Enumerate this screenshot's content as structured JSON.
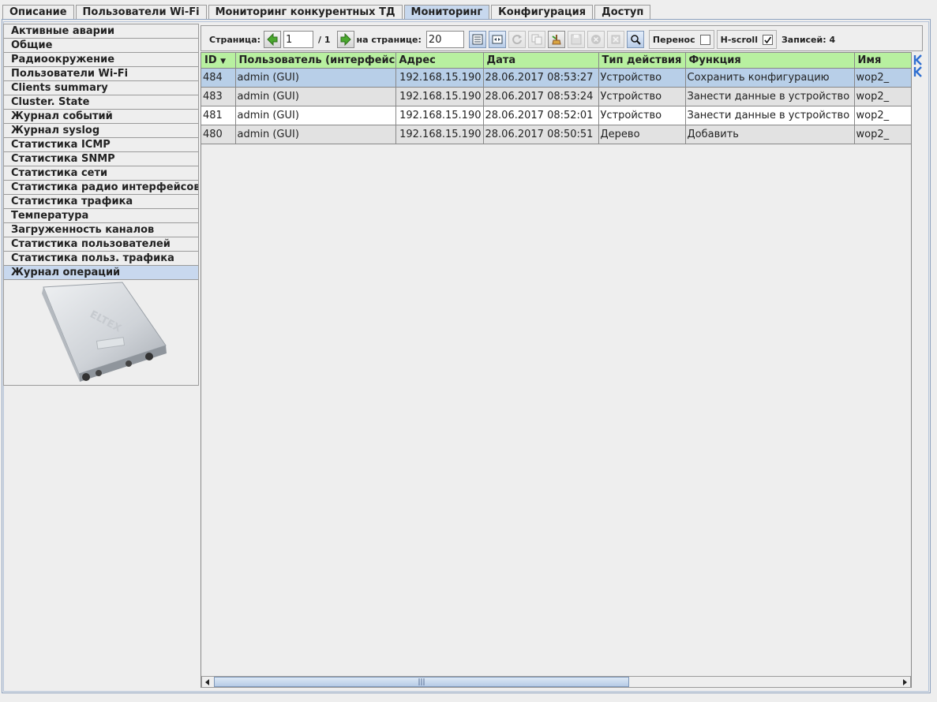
{
  "tabs": [
    {
      "label": "Описание",
      "active": false
    },
    {
      "label": "Пользователи Wi-Fi",
      "active": false
    },
    {
      "label": "Мониторинг конкурентных ТД",
      "active": false
    },
    {
      "label": "Мониторинг",
      "active": true
    },
    {
      "label": "Конфигурация",
      "active": false
    },
    {
      "label": "Доступ",
      "active": false
    }
  ],
  "sidebar": {
    "items": [
      {
        "label": "Активные аварии"
      },
      {
        "label": "Общие"
      },
      {
        "label": "Радиоокружение"
      },
      {
        "label": "Пользователи Wi-Fi"
      },
      {
        "label": "Clients summary"
      },
      {
        "label": "Cluster. State"
      },
      {
        "label": "Журнал событий"
      },
      {
        "label": "Журнал syslog"
      },
      {
        "label": "Статистика ICMP"
      },
      {
        "label": "Статистика SNMP"
      },
      {
        "label": "Статистика сети"
      },
      {
        "label": "Статистика радио интерфейсов"
      },
      {
        "label": "Статистика трафика"
      },
      {
        "label": "Температура"
      },
      {
        "label": "Загруженность каналов"
      },
      {
        "label": "Статистика пользователей"
      },
      {
        "label": "Статистика польз. трафика"
      },
      {
        "label": "Журнал операций",
        "active": true
      }
    ],
    "device_logo": "ELTEX"
  },
  "toolbar": {
    "page_label": "Страница:",
    "page_value": "1",
    "page_total": "/ 1",
    "per_page_label": "на странице:",
    "per_page_value": "20",
    "wrap_label": "Перенос",
    "wrap_checked": false,
    "hscroll_label": "H-scroll",
    "hscroll_checked": true,
    "records_label": "Записей: 4"
  },
  "table": {
    "columns": [
      "ID",
      "Пользователь (интерфейс)",
      "Адрес",
      "Дата",
      "Тип действия",
      "Функция",
      "Имя"
    ],
    "sort_column": "ID",
    "rows": [
      {
        "id": "484",
        "user": "admin (GUI)",
        "address": "192.168.15.190",
        "date": "28.06.2017 08:53:27",
        "action": "Устройство",
        "function": "Сохранить конфигурацию",
        "name": "wop2_",
        "selected": true
      },
      {
        "id": "483",
        "user": "admin (GUI)",
        "address": "192.168.15.190",
        "date": "28.06.2017 08:53:24",
        "action": "Устройство",
        "function": "Занести данные в устройство",
        "name": "wop2_"
      },
      {
        "id": "481",
        "user": "admin (GUI)",
        "address": "192.168.15.190",
        "date": "28.06.2017 08:52:01",
        "action": "Устройство",
        "function": "Занести данные в устройство",
        "name": "wop2_"
      },
      {
        "id": "480",
        "user": "admin (GUI)",
        "address": "192.168.15.190",
        "date": "28.06.2017 08:50:51",
        "action": "Дерево",
        "function": "Добавить",
        "name": "wop2_"
      }
    ]
  },
  "colors": {
    "header_green": "#b8f0a0",
    "selection_blue": "#b8cfe8",
    "active_tab": "#c7d8ee"
  }
}
